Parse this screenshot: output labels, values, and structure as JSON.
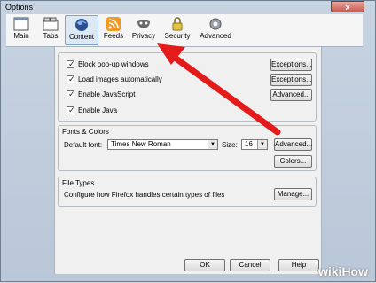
{
  "window": {
    "title": "Options",
    "close_label": "x"
  },
  "tabs": [
    {
      "label": "Main",
      "icon": "main-window-icon"
    },
    {
      "label": "Tabs",
      "icon": "tabs-icon"
    },
    {
      "label": "Content",
      "icon": "content-globe-icon"
    },
    {
      "label": "Feeds",
      "icon": "feeds-icon"
    },
    {
      "label": "Privacy",
      "icon": "privacy-mask-icon"
    },
    {
      "label": "Security",
      "icon": "security-lock-icon"
    },
    {
      "label": "Advanced",
      "icon": "advanced-gear-icon"
    }
  ],
  "content": {
    "checkboxes": [
      {
        "label": "Block pop-up windows",
        "checked": true,
        "button": "Exceptions..."
      },
      {
        "label": "Load images automatically",
        "checked": true,
        "button": "Exceptions..."
      },
      {
        "label": "Enable JavaScript",
        "checked": true,
        "button": "Advanced..."
      },
      {
        "label": "Enable Java",
        "checked": true,
        "button": ""
      }
    ],
    "fonts": {
      "group_title": "Fonts & Colors",
      "default_font_label": "Default font:",
      "default_font_value": "Times New Roman",
      "size_label": "Size:",
      "size_value": "16",
      "advanced_button": "Advanced...",
      "colors_button": "Colors..."
    },
    "file_types": {
      "group_title": "File Types",
      "description": "Configure how Firefox handles certain types of files",
      "manage_button": "Manage..."
    }
  },
  "footer": {
    "ok": "OK",
    "cancel": "Cancel",
    "help": "Help"
  },
  "watermark": {
    "wiki": "wiki",
    "how": "How"
  },
  "colors": {
    "arrow": "#e31b1b",
    "accent": "#7fa2cf"
  }
}
